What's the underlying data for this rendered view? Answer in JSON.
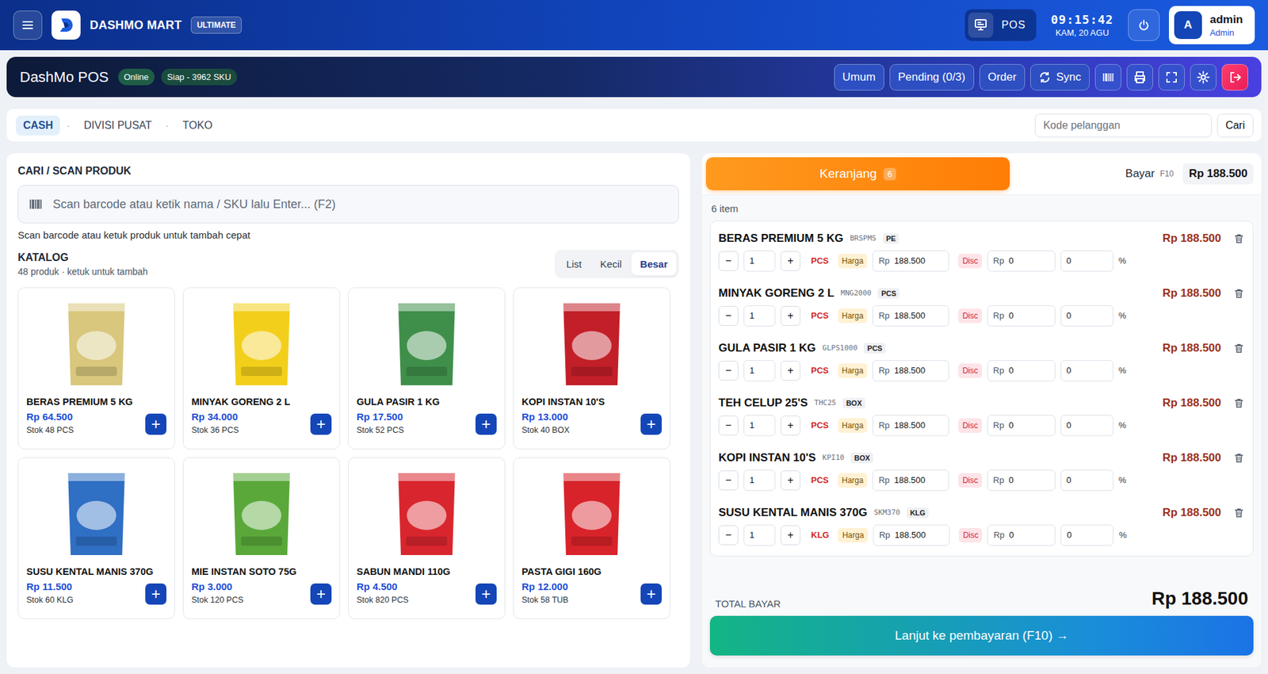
{
  "header": {
    "brand": "DASHMO MART",
    "edition": "ULTIMATE",
    "pos": "POS",
    "time": "09:15:42",
    "date": "KAM, 20 AGU",
    "user": {
      "avatar": "A",
      "name": "admin",
      "role": "Admin"
    }
  },
  "toolbar": {
    "title": "DashMo POS",
    "status": "Online",
    "sku": "Siap - 3962 SKU",
    "buttons": [
      {
        "label": "Umum",
        "kind": "text"
      },
      {
        "label": "Pending (0/3)",
        "kind": "text"
      },
      {
        "label": "Order",
        "kind": "text"
      },
      {
        "label": "Sync",
        "kind": "sync"
      }
    ]
  },
  "context": {
    "separator": "·",
    "crumbs": [
      {
        "label": "CASH",
        "selected": true
      },
      {
        "label": "DIVISI PUSAT",
        "selected": false
      },
      {
        "label": "TOKO",
        "selected": false
      }
    ],
    "customer": {
      "placeholder": "Kode pelanggan"
    },
    "search_button": "Cari"
  },
  "search": {
    "title": "CARI / SCAN PRODUK",
    "placeholder": "Scan barcode atau ketik nama / SKU lalu Enter... (F2)",
    "hint": "Scan barcode atau ketuk produk untuk tambah cepat"
  },
  "catalog": {
    "title": "KATALOG",
    "subtitle": "48 produk · ketuk untuk tambah",
    "views": [
      {
        "label": "List",
        "selected": false
      },
      {
        "label": "Kecil",
        "selected": false
      },
      {
        "label": "Besar",
        "selected": true
      }
    ],
    "add": "+",
    "products": [
      {
        "name": "BERAS PREMIUM 5 KG",
        "price": "Rp 64.500",
        "stock": "Stok 48 PCS",
        "color": "#d8c77c"
      },
      {
        "name": "MINYAK GORENG 2 L",
        "price": "Rp 34.000",
        "stock": "Stok 36 PCS",
        "color": "#f2cf1b"
      },
      {
        "name": "GULA PASIR 1 KG",
        "price": "Rp 17.500",
        "stock": "Stok 52 PCS",
        "color": "#3f8f4a"
      },
      {
        "name": "KOPI INSTAN 10'S",
        "price": "Rp 13.000",
        "stock": "Stok 40 BOX",
        "color": "#c21f28"
      },
      {
        "name": "SUSU KENTAL MANIS 370G",
        "price": "Rp 11.500",
        "stock": "Stok 60 KLG",
        "color": "#2f6fc4"
      },
      {
        "name": "MIE INSTAN SOTO 75G",
        "price": "Rp 3.000",
        "stock": "Stok 120 PCS",
        "color": "#5aa83a"
      },
      {
        "name": "SABUN MANDI 110G",
        "price": "Rp 4.500",
        "stock": "Stok 820 PCS",
        "color": "#d9262e"
      },
      {
        "name": "PASTA GIGI 160G",
        "price": "Rp 12.000",
        "stock": "Stok 58 TUB",
        "color": "#d8232a"
      }
    ]
  },
  "cart": {
    "tab": "Keranjang",
    "count": "6",
    "pay_label": "Bayar",
    "pay_key": "F10",
    "pay_amount": "Rp 188.500",
    "items_count": "6 item",
    "labels": {
      "minus": "−",
      "plus": "+",
      "harga": "Harga",
      "disc": "Disc",
      "currency": "Rp",
      "percent": "%"
    },
    "items": [
      {
        "name": "BERAS PREMIUM 5 KG",
        "sku": "BRSPMS",
        "tag": "PE",
        "unit": "PCS",
        "qty": "1",
        "price": "188.500",
        "disc": "0",
        "disc_pct": "0",
        "total": "Rp 188.500"
      },
      {
        "name": "MINYAK GORENG 2 L",
        "sku": "MNG2000",
        "tag": "PCS",
        "unit": "PCS",
        "qty": "1",
        "price": "188.500",
        "disc": "0",
        "disc_pct": "0",
        "total": "Rp 188.500"
      },
      {
        "name": "GULA PASIR 1 KG",
        "sku": "GLPS1000",
        "tag": "PCS",
        "unit": "PCS",
        "qty": "1",
        "price": "188.500",
        "disc": "0",
        "disc_pct": "0",
        "total": "Rp 188.500"
      },
      {
        "name": "TEH CELUP 25'S",
        "sku": "THC25",
        "tag": "BOX",
        "unit": "PCS",
        "qty": "1",
        "price": "188.500",
        "disc": "0",
        "disc_pct": "0",
        "total": "Rp 188.500"
      },
      {
        "name": "KOPI INSTAN 10'S",
        "sku": "KPI10",
        "tag": "BOX",
        "unit": "PCS",
        "qty": "1",
        "price": "188.500",
        "disc": "0",
        "disc_pct": "0",
        "total": "Rp 188.500"
      },
      {
        "name": "SUSU KENTAL MANIS 370G",
        "sku": "SKM370",
        "tag": "KLG",
        "unit": "KLG",
        "qty": "1",
        "price": "188.500",
        "disc": "0",
        "disc_pct": "0",
        "total": "Rp 188.500"
      }
    ],
    "total_label": "TOTAL BAYAR",
    "total": "Rp 188.500",
    "checkout": "Lanjut ke pembayaran (F10) →"
  }
}
